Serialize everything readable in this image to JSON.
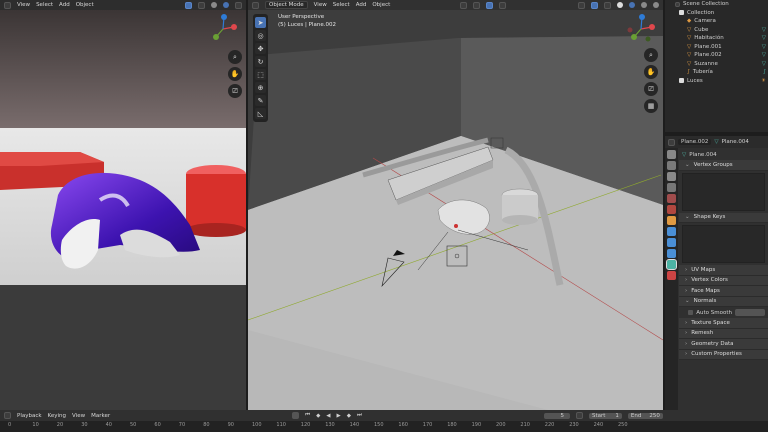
{
  "left_header": {
    "menus": [
      "View",
      "Select",
      "Add",
      "Object"
    ]
  },
  "main_header": {
    "mode": "Object Mode",
    "menus": [
      "View",
      "Select",
      "Add",
      "Object"
    ]
  },
  "viewport_info": {
    "line1": "User Perspective",
    "line2": "(5) Luces | Plane.002"
  },
  "outliner": {
    "scene": "Scene Collection",
    "collection": "Collection",
    "items": [
      "Camera",
      "Cube",
      "Habitación",
      "Plane.001",
      "Plane.002",
      "Suzanne",
      "Tubería"
    ],
    "second_collection": "Luces"
  },
  "properties": {
    "object_name": "Plane.002",
    "data_name": "Plane.004",
    "mesh_name": "Plane.004",
    "sections": [
      "Vertex Groups",
      "Shape Keys",
      "UV Maps",
      "Vertex Colors",
      "Face Maps",
      "Normals",
      "Texture Space",
      "Remesh",
      "Geometry Data",
      "Custom Properties"
    ],
    "auto_smooth": "Auto Smooth"
  },
  "timeline": {
    "menus": [
      "Playback",
      "Keying",
      "View",
      "Marker"
    ],
    "current_frame": "5",
    "start_label": "Start",
    "start_value": "1",
    "end_label": "End",
    "end_value": "250",
    "ticks": [
      "0",
      "10",
      "20",
      "30",
      "40",
      "50",
      "60",
      "70",
      "80",
      "90",
      "100",
      "110",
      "120",
      "130",
      "140",
      "150",
      "160",
      "170",
      "180",
      "190",
      "200",
      "210",
      "220",
      "230",
      "240",
      "250"
    ]
  },
  "colors": {
    "accent": "#4772b3",
    "header": "#303030",
    "panel": "#303030",
    "background": "#1d1d1d"
  }
}
